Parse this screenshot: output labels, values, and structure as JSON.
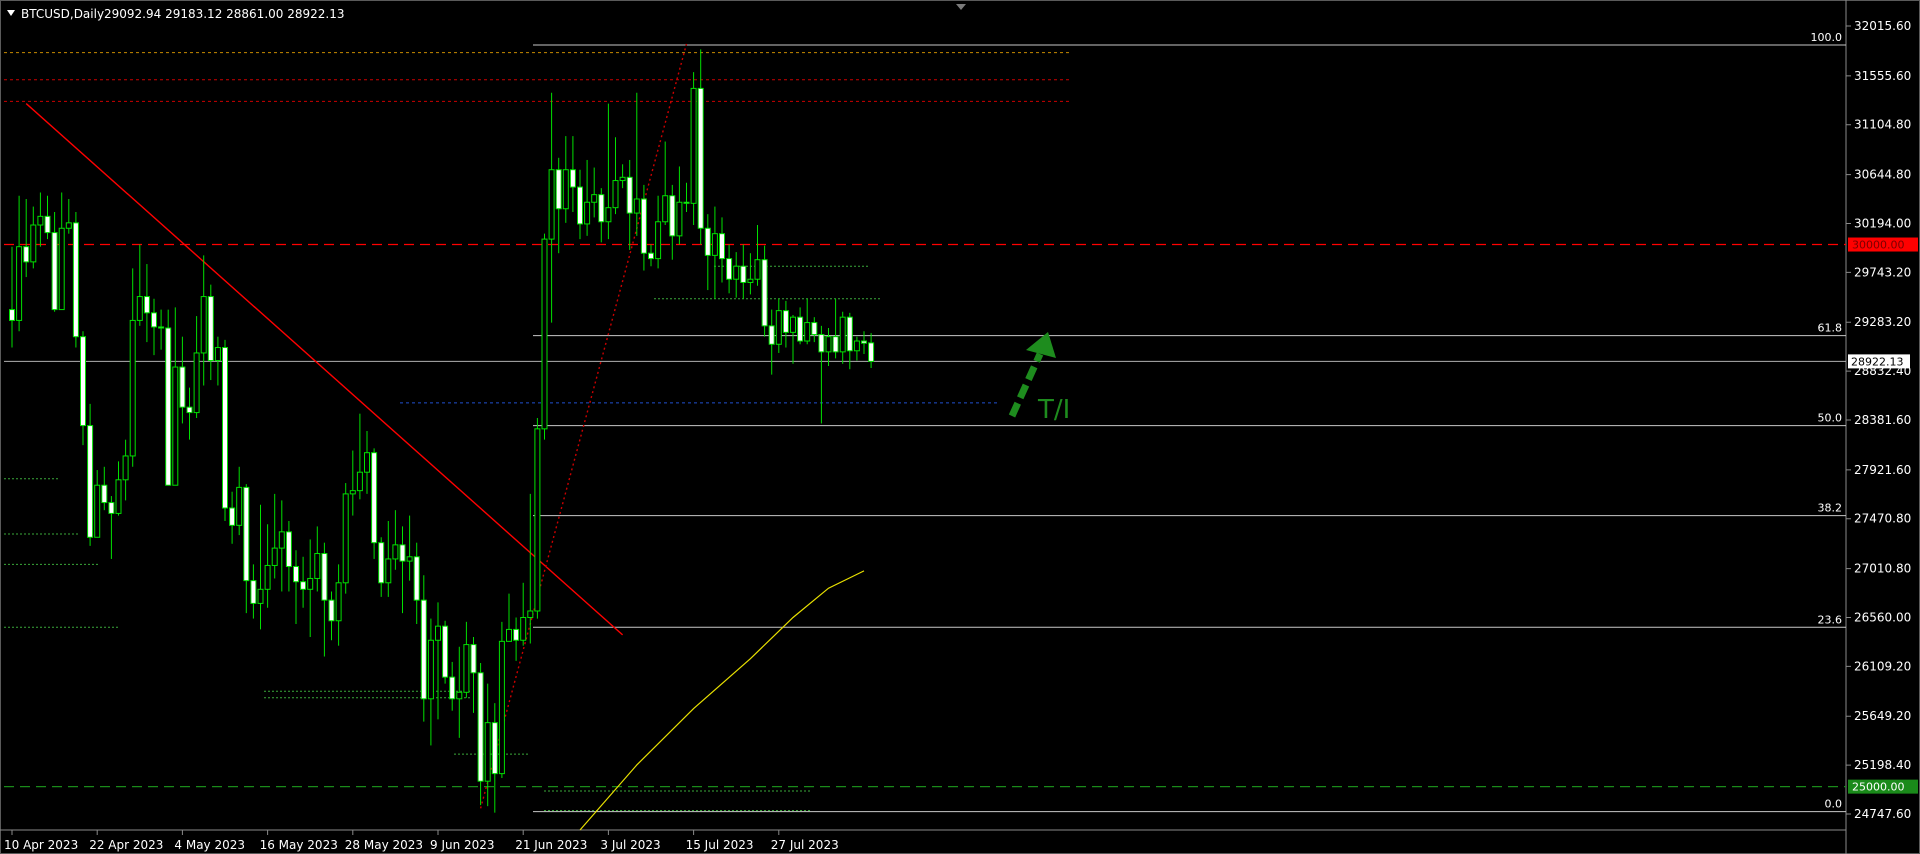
{
  "header": {
    "symbol_label": "BTCUSD,Daily",
    "ohlc_label": "29092.94 29183.12 28861.00 28922.13"
  },
  "chart_data": {
    "type": "candlestick",
    "symbol": "BTCUSD",
    "timeframe": "Daily",
    "last": {
      "open": 29092.94,
      "high": 29183.12,
      "low": 28861.0,
      "close": 28922.13
    },
    "ylim": [
      24600,
      32200
    ],
    "y_ticks": [
      32015.6,
      31555.6,
      31104.8,
      30644.8,
      30194.0,
      29743.2,
      29283.2,
      28832.4,
      28381.6,
      27921.6,
      27470.8,
      27010.8,
      26560.0,
      26109.2,
      25649.2,
      25198.4,
      24747.6
    ],
    "x_ticks": [
      "10 Apr 2023",
      "22 Apr 2023",
      "4 May 2023",
      "16 May 2023",
      "28 May 2023",
      "9 Jun 2023",
      "21 Jun 2023",
      "3 Jul 2023",
      "15 Jul 2023",
      "27 Jul 2023"
    ],
    "x_tick_index": [
      0,
      12,
      24,
      36,
      48,
      60,
      72,
      84,
      96,
      108
    ],
    "candles": [
      [
        29400,
        29300,
        29980,
        29050
      ],
      [
        29300,
        29980,
        30450,
        29200
      ],
      [
        29980,
        29840,
        30420,
        29700
      ],
      [
        29840,
        30180,
        30350,
        29780
      ],
      [
        30180,
        30260,
        30480,
        29980
      ],
      [
        30260,
        30110,
        30450,
        30050
      ],
      [
        30110,
        29400,
        30300,
        29380
      ],
      [
        29400,
        30150,
        30480,
        29400
      ],
      [
        30150,
        30200,
        30420,
        30100
      ],
      [
        30200,
        29150,
        30300,
        29050
      ],
      [
        29150,
        28330,
        29200,
        28150
      ],
      [
        28330,
        27300,
        28530,
        27220
      ],
      [
        27300,
        27780,
        27920,
        27300
      ],
      [
        27780,
        27620,
        27950,
        27550
      ],
      [
        27620,
        27520,
        27680,
        27100
      ],
      [
        27520,
        27830,
        28000,
        27500
      ],
      [
        27830,
        28050,
        28200,
        27640
      ],
      [
        28050,
        29300,
        29780,
        27950
      ],
      [
        29300,
        29520,
        30000,
        29250
      ],
      [
        29520,
        29370,
        29820,
        29100
      ],
      [
        29370,
        29240,
        29500,
        28980
      ],
      [
        29240,
        29230,
        29400,
        29030
      ],
      [
        29230,
        27780,
        29400,
        27780
      ],
      [
        27780,
        28870,
        29420,
        27800
      ],
      [
        28870,
        28500,
        29150,
        28350
      ],
      [
        28500,
        28450,
        28680,
        28200
      ],
      [
        28450,
        29000,
        29340,
        28400
      ],
      [
        29000,
        29520,
        29900,
        28700
      ],
      [
        29520,
        28930,
        29630,
        28750
      ],
      [
        28930,
        29050,
        29150,
        28700
      ],
      [
        29050,
        27570,
        29120,
        27450
      ],
      [
        27570,
        27410,
        27720,
        27240
      ],
      [
        27410,
        27760,
        27950,
        27320
      ],
      [
        27760,
        26900,
        27790,
        26600
      ],
      [
        26900,
        26690,
        27050,
        26550
      ],
      [
        26690,
        26820,
        27600,
        26450
      ],
      [
        26820,
        27040,
        27420,
        26650
      ],
      [
        27040,
        27200,
        27700,
        26920
      ],
      [
        27200,
        27350,
        27640,
        26800
      ],
      [
        27350,
        27030,
        27450,
        26800
      ],
      [
        27030,
        26890,
        27180,
        26500
      ],
      [
        26890,
        26820,
        27120,
        26650
      ],
      [
        26820,
        26920,
        27280,
        26380
      ],
      [
        26920,
        27150,
        27400,
        26800
      ],
      [
        27150,
        26720,
        27250,
        26200
      ],
      [
        26720,
        26530,
        26800,
        26350
      ],
      [
        26530,
        26880,
        27050,
        26300
      ],
      [
        26880,
        27700,
        27800,
        26780
      ],
      [
        27700,
        27730,
        28100,
        27500
      ],
      [
        27730,
        27900,
        28440,
        27650
      ],
      [
        27900,
        28080,
        28280,
        27700
      ],
      [
        28080,
        27250,
        28120,
        27100
      ],
      [
        27250,
        26880,
        27300,
        26750
      ],
      [
        26880,
        27100,
        27450,
        26750
      ],
      [
        27100,
        27230,
        27550,
        27000
      ],
      [
        27230,
        27080,
        27400,
        26600
      ],
      [
        27080,
        27120,
        27500,
        26900
      ],
      [
        27120,
        26720,
        27250,
        26500
      ],
      [
        26720,
        25810,
        26950,
        25600
      ],
      [
        25810,
        26350,
        26550,
        25380
      ],
      [
        26350,
        26480,
        26700,
        25620
      ],
      [
        26480,
        26010,
        26530,
        25950
      ],
      [
        26010,
        25810,
        26150,
        25700
      ],
      [
        25810,
        25870,
        26290,
        25450
      ],
      [
        25870,
        26310,
        26520,
        25820
      ],
      [
        26310,
        26050,
        26380,
        25680
      ],
      [
        26050,
        25050,
        26140,
        24830
      ],
      [
        25050,
        25590,
        25950,
        24820
      ],
      [
        25590,
        25120,
        25770,
        24760
      ],
      [
        25120,
        26340,
        26520,
        25080
      ],
      [
        26340,
        26450,
        26780,
        26340
      ],
      [
        26450,
        26350,
        26560,
        26160
      ],
      [
        26350,
        26560,
        26880,
        26300
      ],
      [
        26560,
        26620,
        27700,
        26320
      ],
      [
        26620,
        28300,
        28400,
        26550
      ],
      [
        28300,
        30050,
        30100,
        28200
      ],
      [
        30050,
        30690,
        31400,
        29280
      ],
      [
        30690,
        30330,
        30800,
        29920
      ],
      [
        30330,
        30690,
        31000,
        30200
      ],
      [
        30690,
        30530,
        31000,
        30300
      ],
      [
        30530,
        30190,
        30690,
        30050
      ],
      [
        30190,
        30390,
        30780,
        30080
      ],
      [
        30390,
        30460,
        30710,
        30250
      ],
      [
        30460,
        30210,
        30520,
        30020
      ],
      [
        30210,
        30340,
        31300,
        30050
      ],
      [
        30340,
        30590,
        30990,
        30280
      ],
      [
        30590,
        30620,
        30740,
        30520
      ],
      [
        30620,
        30290,
        30780,
        29950
      ],
      [
        30290,
        30420,
        31400,
        30080
      ],
      [
        30420,
        29920,
        30550,
        29760
      ],
      [
        29920,
        29870,
        30000,
        29800
      ],
      [
        29870,
        30210,
        30450,
        29780
      ],
      [
        30210,
        30450,
        30950,
        30180
      ],
      [
        30450,
        30080,
        30550,
        29860
      ],
      [
        30080,
        30390,
        30720,
        30000
      ],
      [
        30390,
        30380,
        30570,
        30300
      ],
      [
        30380,
        31440,
        31590,
        30180
      ],
      [
        31440,
        30150,
        31800,
        30000
      ],
      [
        30150,
        29900,
        30280,
        29580
      ],
      [
        29900,
        30100,
        30350,
        29500
      ],
      [
        30100,
        29870,
        30250,
        29650
      ],
      [
        29870,
        29680,
        30000,
        29550
      ],
      [
        29680,
        29800,
        29930,
        29510
      ],
      [
        29800,
        29650,
        30000,
        29500
      ],
      [
        29650,
        29680,
        29920,
        29540
      ],
      [
        29680,
        29860,
        30180,
        29620
      ],
      [
        29860,
        29250,
        29990,
        29150
      ],
      [
        29250,
        29080,
        29400,
        28800
      ],
      [
        29080,
        29390,
        29500,
        29000
      ],
      [
        29390,
        29190,
        29480,
        29050
      ],
      [
        29190,
        29330,
        29350,
        28900
      ],
      [
        29330,
        29110,
        29420,
        29080
      ],
      [
        29110,
        29280,
        29500,
        29080
      ],
      [
        29280,
        29170,
        29330,
        29100
      ],
      [
        29170,
        29010,
        29250,
        28350
      ],
      [
        29010,
        29150,
        29230,
        28880
      ],
      [
        29150,
        29010,
        29500,
        28950
      ],
      [
        29010,
        29330,
        29380,
        28900
      ],
      [
        29330,
        29020,
        29370,
        28850
      ],
      [
        29020,
        29110,
        29150,
        28930
      ],
      [
        29110,
        29090,
        29200,
        28990
      ],
      [
        29092.94,
        28922.13,
        29183.12,
        28861.0
      ]
    ],
    "trendline": {
      "from": [
        31300,
        2
      ],
      "to": [
        26400,
        86
      ],
      "color": "#ff0000"
    },
    "dotted_trendline": {
      "from": [
        24800,
        66
      ],
      "to": [
        31850,
        95
      ],
      "color": "#cc0000"
    },
    "moving_average": {
      "color": "#e8e000",
      "points": [
        [
          80,
          24600
        ],
        [
          88,
          25200
        ],
        [
          96,
          25720
        ],
        [
          104,
          26180
        ],
        [
          110,
          26560
        ],
        [
          115,
          26830
        ],
        [
          120,
          26990
        ]
      ]
    },
    "fibonacci": {
      "levels": [
        {
          "label": "100.0",
          "price": 31840
        },
        {
          "label": "61.8",
          "price": 29160
        },
        {
          "label": "50.0",
          "price": 28330
        },
        {
          "label": "38.2",
          "price": 27500
        },
        {
          "label": "23.6",
          "price": 26470
        },
        {
          "label": "0.0",
          "price": 24770
        }
      ],
      "color": "#c8c8c8"
    },
    "horizontal_levels": [
      {
        "price": 30000.0,
        "label": "30000.00",
        "color": "#ff0000"
      },
      {
        "price": 25000.0,
        "label": "25000.00",
        "color": "#1a8a1a"
      }
    ],
    "last_price_label": "28922.13",
    "annotation": {
      "text": "T/I",
      "color": "#1e8c1e"
    }
  }
}
